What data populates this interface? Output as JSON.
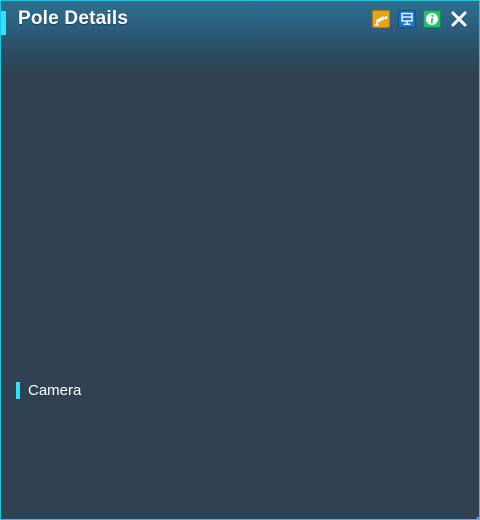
{
  "window": {
    "title": "Pole Details"
  },
  "header_icons": [
    {
      "name": "camera-icon",
      "color": "#e8a316"
    },
    {
      "name": "monitor-icon",
      "color": "#1875c9"
    },
    {
      "name": "info-icon",
      "color": "#1ec26a"
    },
    {
      "name": "close-icon",
      "color": "#ffffff"
    }
  ],
  "sections": {
    "camera_label": "Camera"
  },
  "theme": {
    "accent": "#29e3ff",
    "border": "#1fc6df",
    "background": "#2e4150",
    "header_top": "#2f6f8f"
  }
}
